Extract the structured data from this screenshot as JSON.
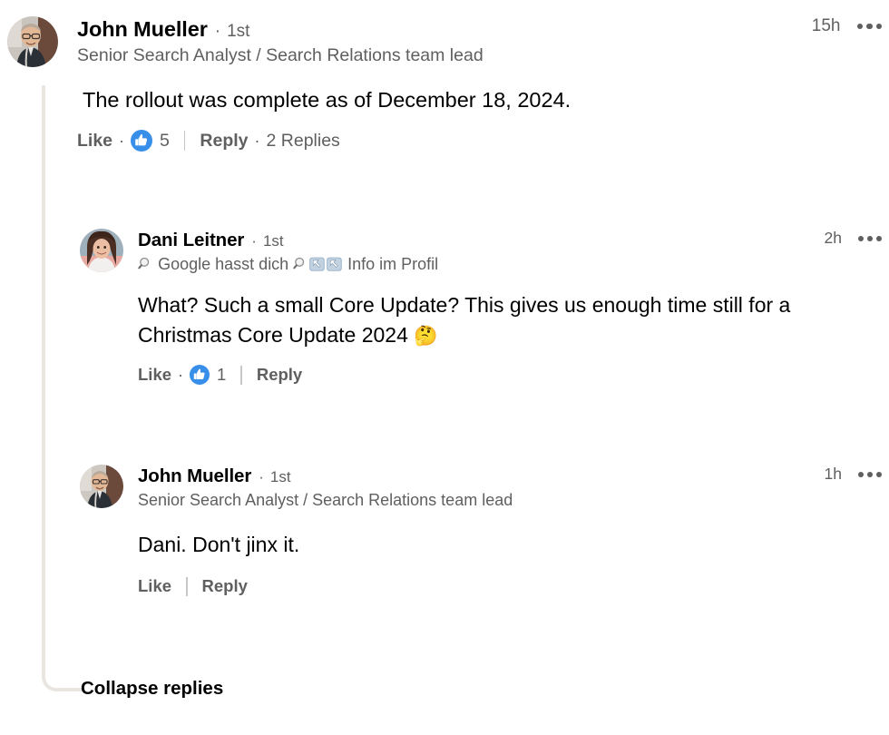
{
  "thread": {
    "collapse_label": "Collapse replies",
    "line_color": "#e9e6e1"
  },
  "colors": {
    "name_text": "#000000",
    "secondary_text": "#5f5f5f",
    "reaction_blue": "#378fe9",
    "divider": "#c7c7c7",
    "background": "#ffffff"
  },
  "comments": [
    {
      "id": "root-comment",
      "author": "John Mueller",
      "degree": "1st",
      "separator": "·",
      "headline": "Senior Search Analyst / Search Relations team lead",
      "timestamp": "15h",
      "text": "The rollout was complete as of December 18, 2024.",
      "actions": {
        "like_label": "Like",
        "reaction_icon": "thumbs-up-icon",
        "reaction_count": "5",
        "reply_label": "Reply",
        "replies_label": "2 Replies",
        "mid_dot": "·"
      }
    },
    {
      "id": "reply-dani",
      "author": "Dani Leitner",
      "degree": "1st",
      "separator": "·",
      "headline_parts": {
        "mag_left": "🔎",
        "mid": "Google hasst dich",
        "mag_right": "🔎",
        "arrow1": "↖️",
        "arrow2": "↖️",
        "tail": "Info im Profil"
      },
      "headline": "🔎 Google hasst dich 🔎 ↖️↖️ Info im Profil",
      "timestamp": "2h",
      "text": "What? Such a small Core Update? This gives us enough time still for a Christmas Core Update 2024 🤔",
      "text_line1": "What? Such a small Core Update? This gives us enough time",
      "text_line2": "still for a Christmas Core Update 2024",
      "text_emoji": "🤔",
      "actions": {
        "like_label": "Like",
        "reaction_icon": "thumbs-up-icon",
        "reaction_count": "1",
        "reply_label": "Reply",
        "mid_dot": "·"
      }
    },
    {
      "id": "reply-john",
      "author": "John Mueller",
      "degree": "1st",
      "separator": "·",
      "headline": "Senior Search Analyst / Search Relations team lead",
      "timestamp": "1h",
      "text": "Dani. Don't jinx it.",
      "actions": {
        "like_label": "Like",
        "reply_label": "Reply"
      }
    }
  ]
}
